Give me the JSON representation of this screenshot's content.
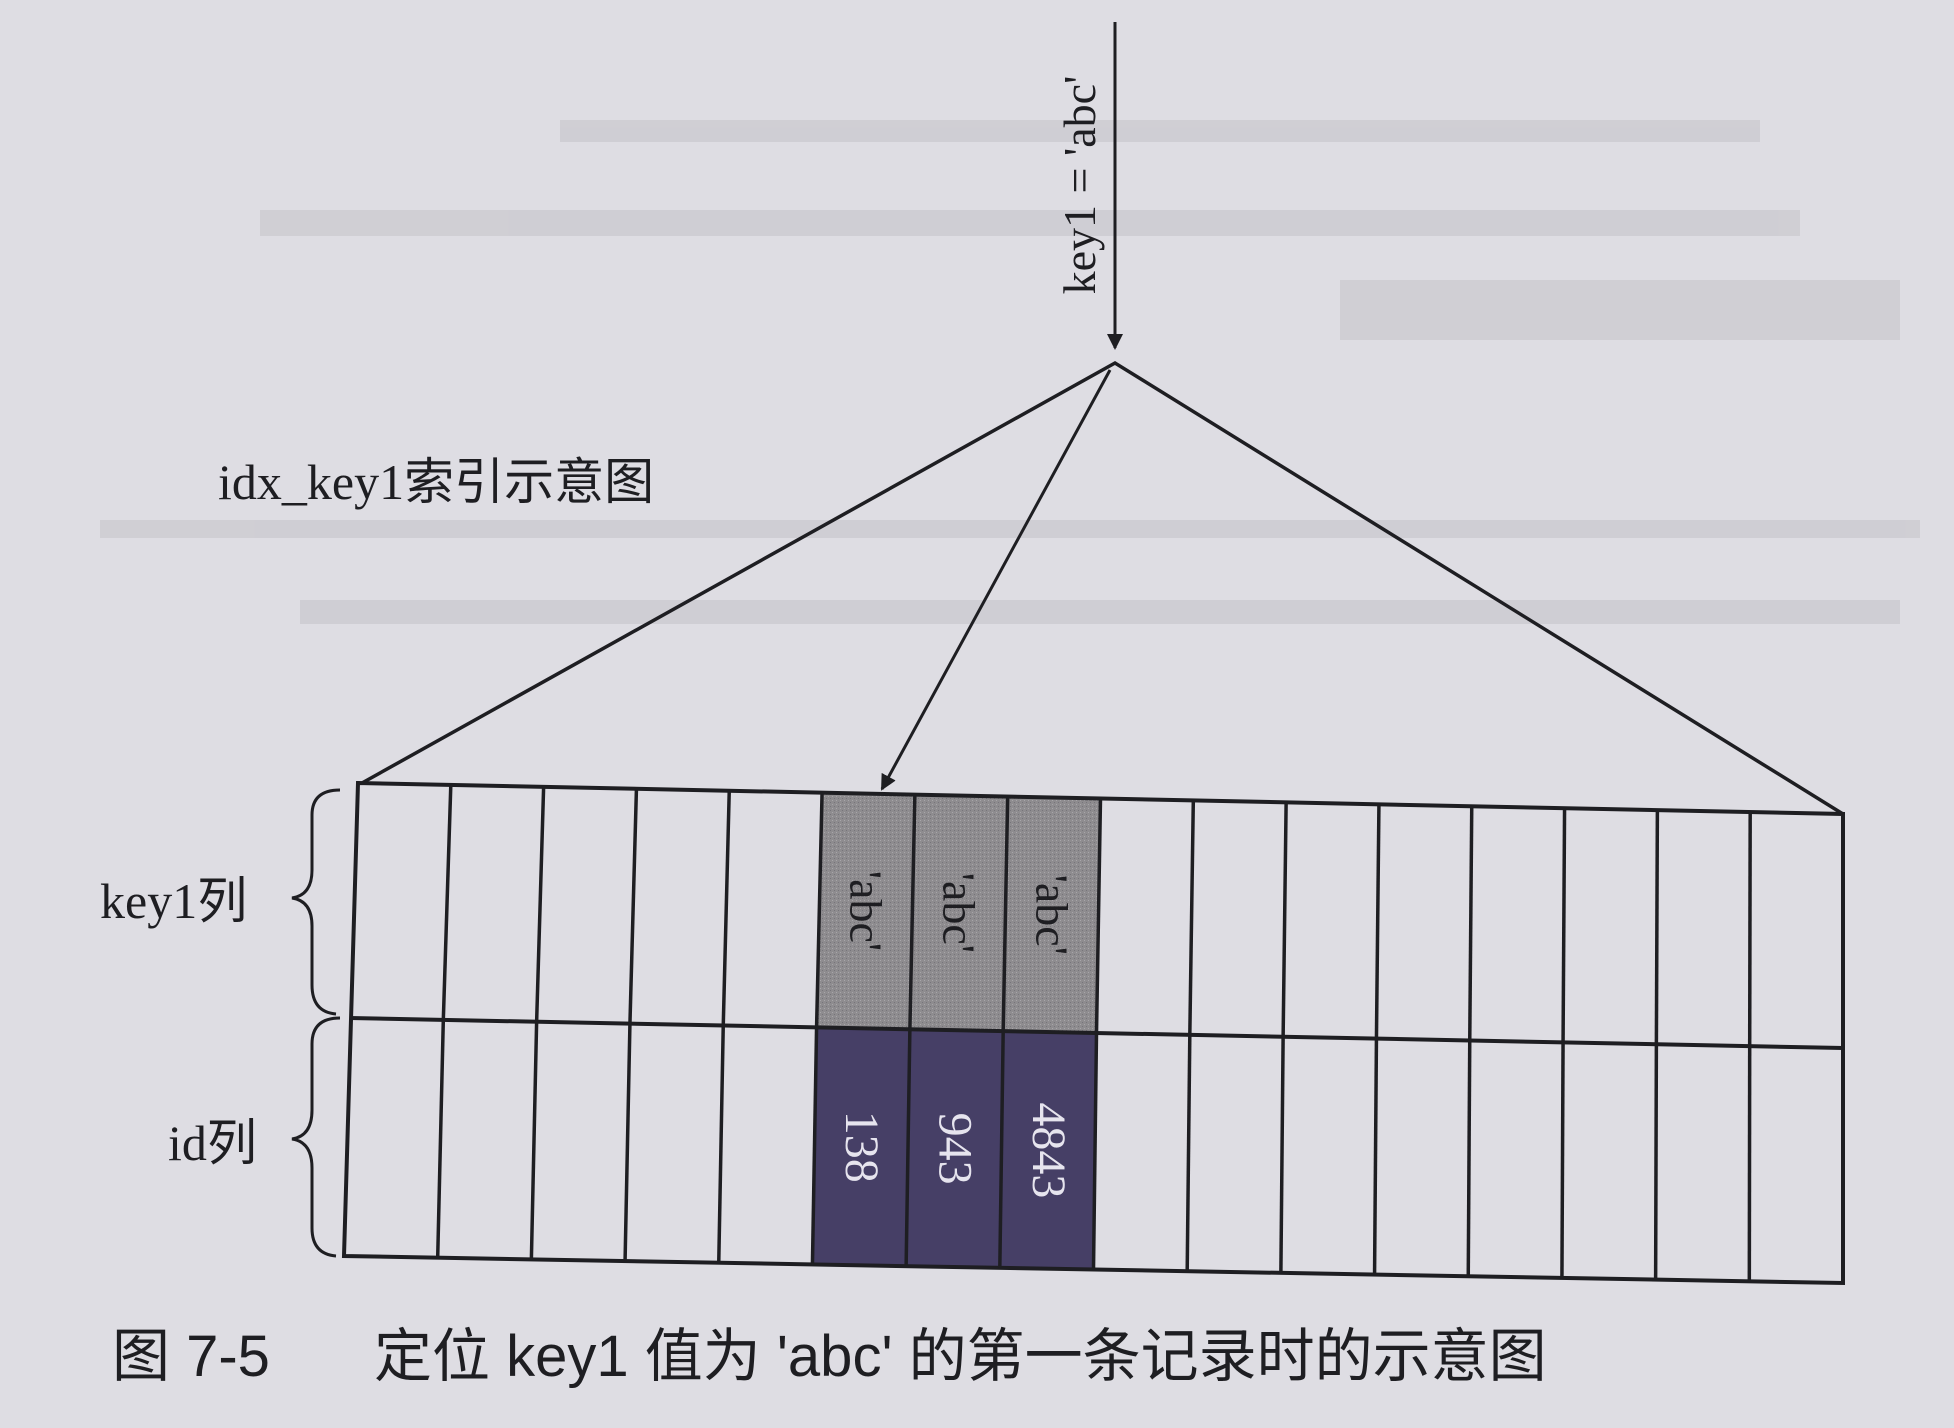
{
  "diagram": {
    "lookup_label": "key1 = 'abc'",
    "index_title": "idx_key1索引示意图",
    "row_labels": {
      "key1": "key1列",
      "id": "id列"
    },
    "highlight": {
      "key1_values": [
        "'abc'",
        "'abc'",
        "'abc'"
      ],
      "id_values": [
        "138",
        "943",
        "4843"
      ]
    },
    "caption": {
      "number": "图 7-5",
      "text": "定位 key1 值为 'abc' 的第一条记录时的示意图"
    }
  },
  "colors": {
    "ink": "#1e1e22",
    "key1_highlight": "#8e8c8f",
    "id_highlight": "#463f66",
    "id_text": "#e6e4ee",
    "paper": "#dedde3"
  }
}
